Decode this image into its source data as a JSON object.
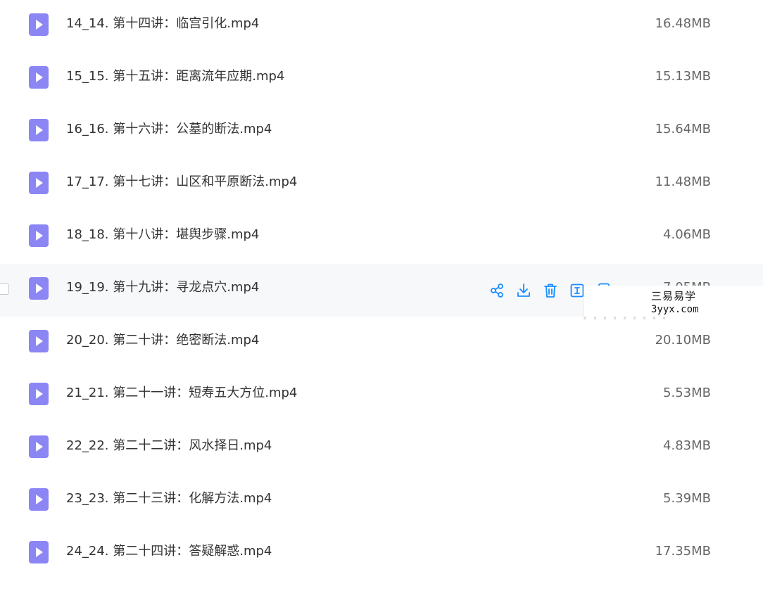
{
  "files": [
    {
      "name": "14_14. 第十四讲：临宫引化.mp4",
      "size": "16.48MB"
    },
    {
      "name": "15_15. 第十五讲：距离流年应期.mp4",
      "size": "15.13MB"
    },
    {
      "name": "16_16. 第十六讲：公墓的断法.mp4",
      "size": "15.64MB"
    },
    {
      "name": "17_17. 第十七讲：山区和平原断法.mp4",
      "size": "11.48MB"
    },
    {
      "name": "18_18. 第十八讲：堪舆步骤.mp4",
      "size": "4.06MB"
    },
    {
      "name": "19_19. 第十九讲：寻龙点穴.mp4",
      "size": "7.05MB"
    },
    {
      "name": "20_20. 第二十讲：绝密断法.mp4",
      "size": "20.10MB"
    },
    {
      "name": "21_21. 第二十一讲：短寿五大方位.mp4",
      "size": "5.53MB"
    },
    {
      "name": "22_22. 第二十二讲：风水择日.mp4",
      "size": "4.83MB"
    },
    {
      "name": "23_23. 第二十三讲：化解方法.mp4",
      "size": "5.39MB"
    },
    {
      "name": "24_24. 第二十四讲：答疑解惑.mp4",
      "size": "17.35MB"
    }
  ],
  "hovered_row_index": 5,
  "row_actions": [
    "share-icon",
    "download-icon",
    "delete-icon",
    "rename-icon",
    "more-icon"
  ],
  "watermark": {
    "line1": "三易易学",
    "line2": "3yyx.com"
  },
  "colors": {
    "icon_purple": "#8b86f4",
    "action_blue": "#1a8cff",
    "hover_bg": "#f7f8fa"
  }
}
